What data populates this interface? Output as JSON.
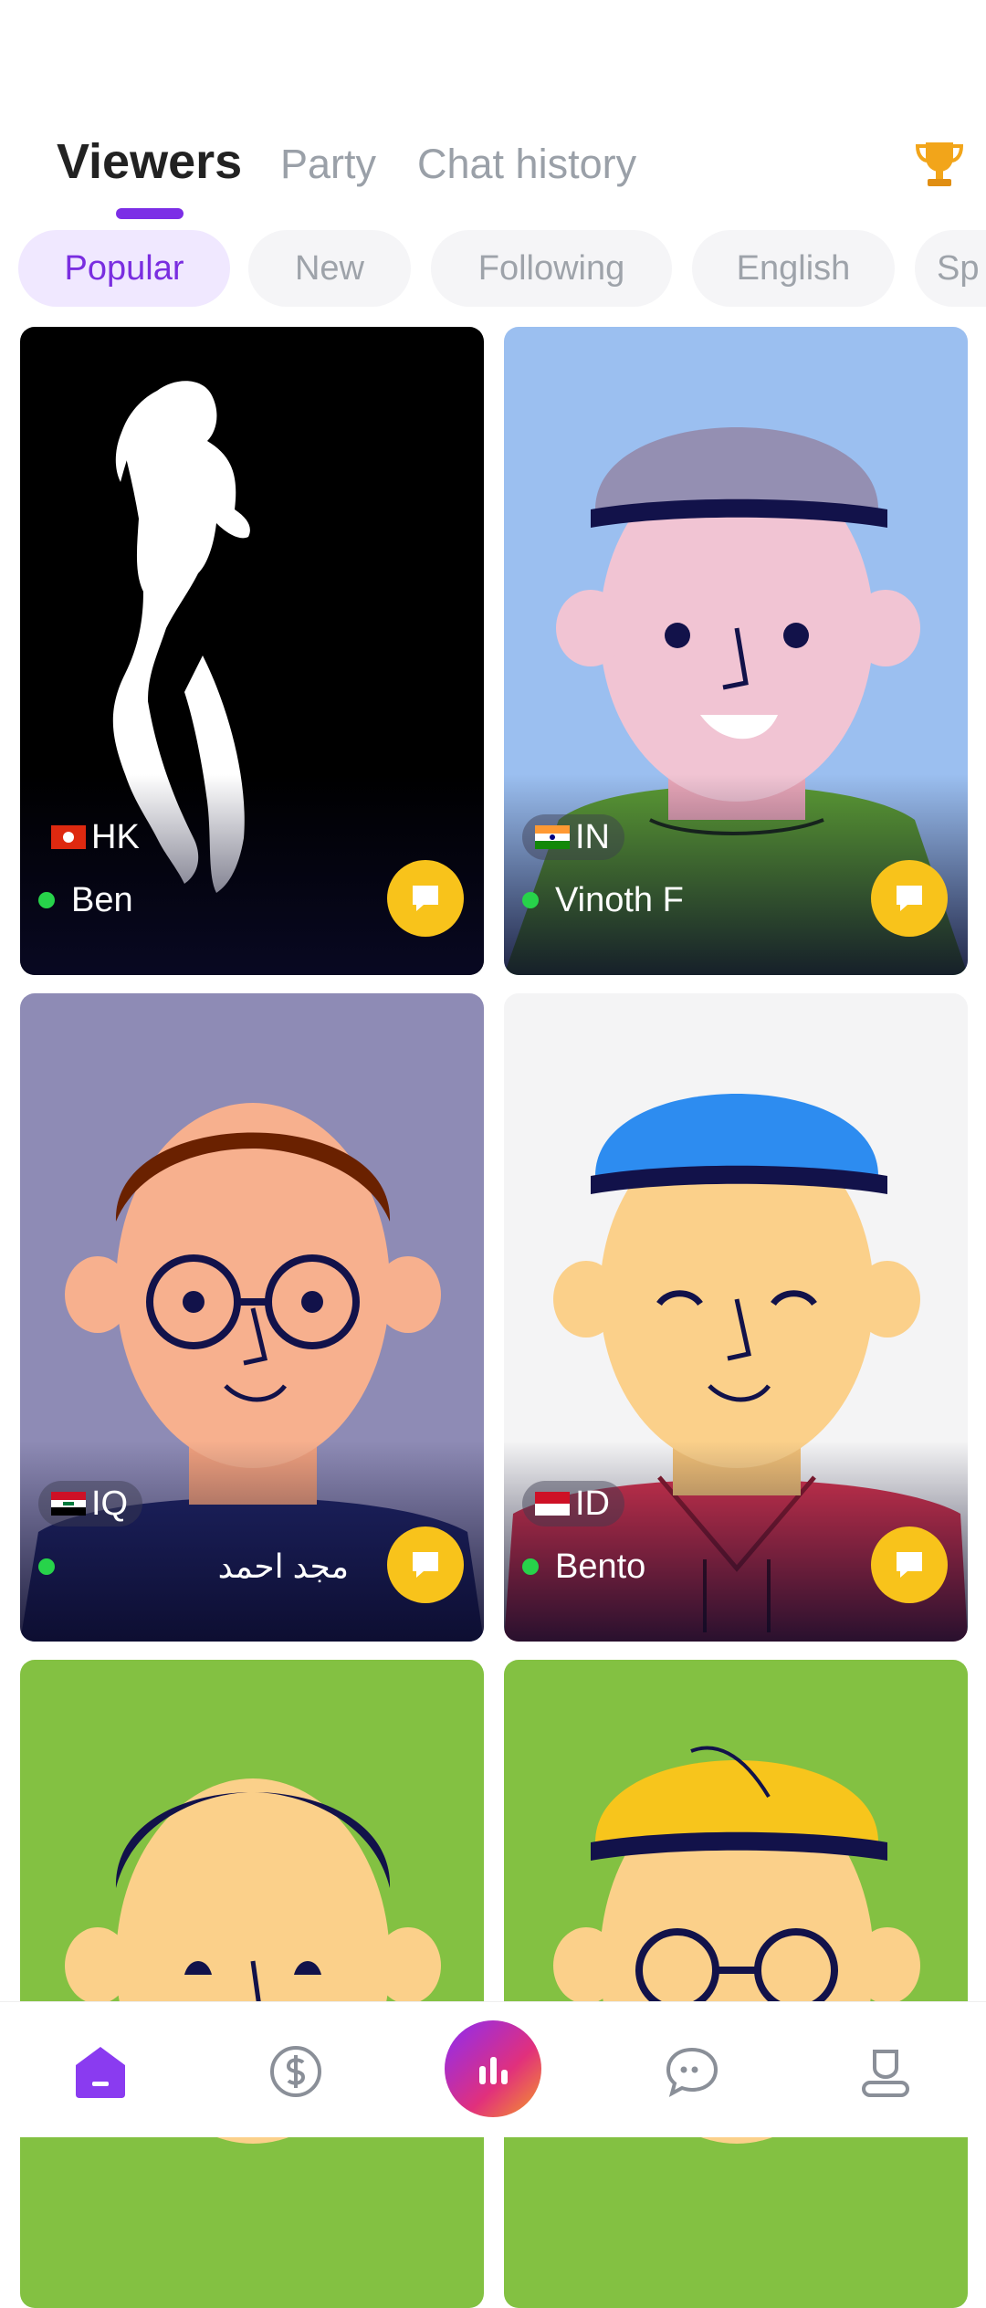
{
  "header": {
    "tabs": [
      {
        "label": "Viewers",
        "active": true
      },
      {
        "label": "Party",
        "active": false
      },
      {
        "label": "Chat history",
        "active": false
      }
    ],
    "trophy_icon": "trophy-icon"
  },
  "filters": [
    {
      "label": "Popular",
      "active": true
    },
    {
      "label": "New",
      "active": false
    },
    {
      "label": "Following",
      "active": false
    },
    {
      "label": "English",
      "active": false
    },
    {
      "label": "Sp",
      "active": false
    }
  ],
  "cards": [
    {
      "country": "HK",
      "name": "Ben",
      "online": true,
      "background": "#000000"
    },
    {
      "country": "IN",
      "name": "Vinoth F",
      "online": true,
      "background": "#9bbff0"
    },
    {
      "country": "IQ",
      "name": "مجد احمد",
      "online": true,
      "background": "#8e8bb5"
    },
    {
      "country": "ID",
      "name": "Bento",
      "online": true,
      "background": "#f4f4f5"
    },
    {
      "country": "",
      "name": "",
      "online": false,
      "background": "#83c142"
    },
    {
      "country": "",
      "name": "",
      "online": false,
      "background": "#83c142"
    }
  ],
  "bottom_nav": [
    {
      "icon": "home-icon",
      "active": true
    },
    {
      "icon": "dollar-icon",
      "active": false
    },
    {
      "icon": "stats-icon",
      "active": false
    },
    {
      "icon": "chat-bubble-icon",
      "active": false
    },
    {
      "icon": "profile-icon",
      "active": false
    }
  ],
  "colors": {
    "accent": "#7c2ee6",
    "chat_button": "#f8c31b",
    "online": "#27d34a"
  }
}
